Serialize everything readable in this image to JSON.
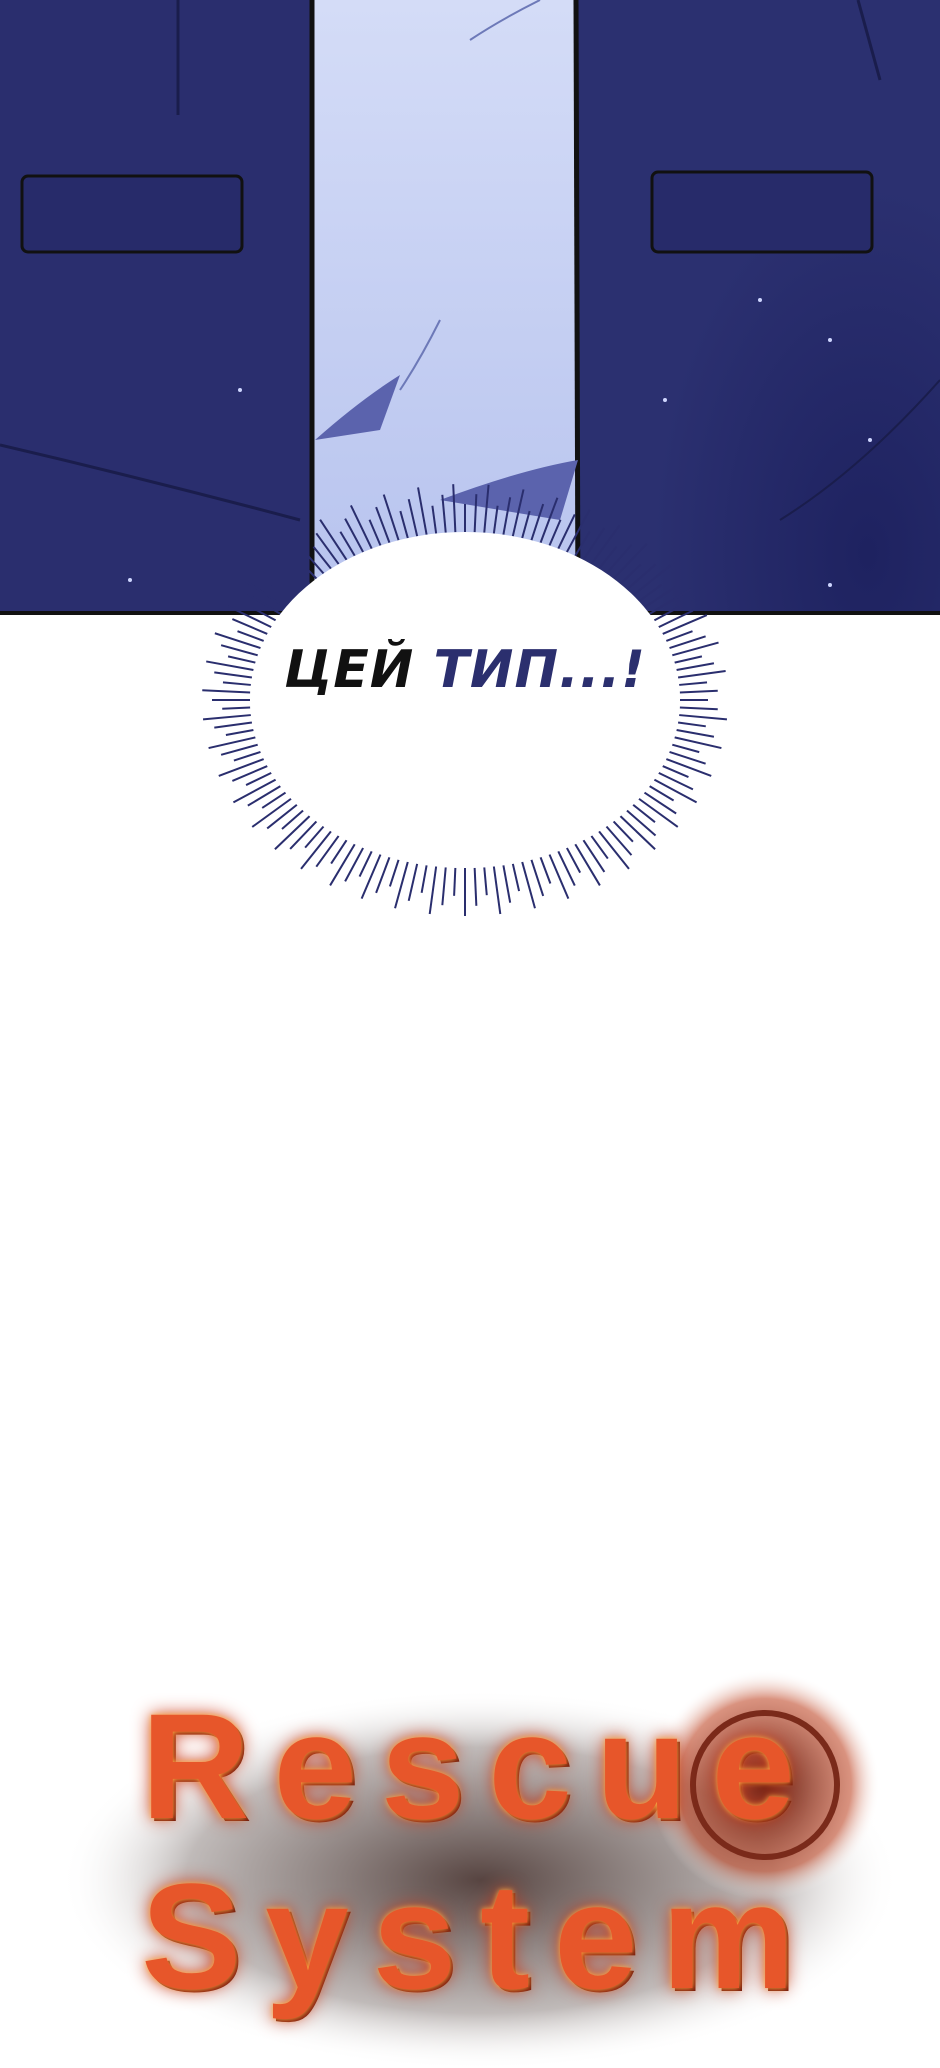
{
  "speech_bubble": {
    "line_part1": "ЦЕЙ",
    "line_part2": "ТИП...!"
  },
  "logo": {
    "line1": "Rescue",
    "line2": "System"
  },
  "colors": {
    "jacket": "#282c6c",
    "shirt": "#c9d3f4",
    "logo_fire": "#e7562a",
    "bubble_text": "#111111"
  }
}
